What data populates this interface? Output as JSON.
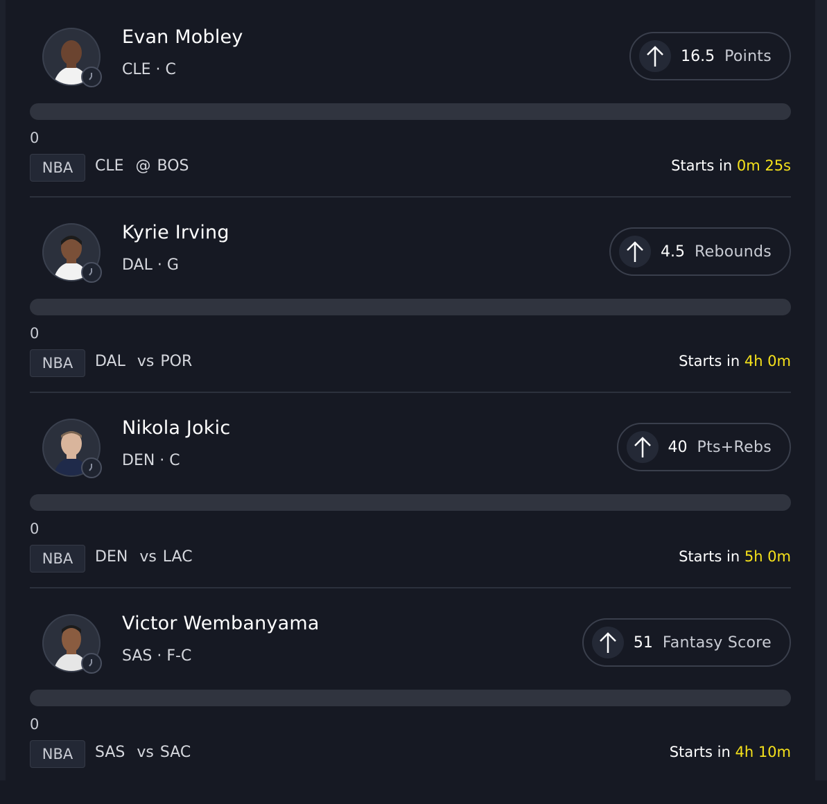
{
  "colors": {
    "background": "#161923",
    "countdown": "#f5e11b",
    "track": "#30343f"
  },
  "cards": [
    {
      "name": "Evan Mobley",
      "meta": "CLE · C",
      "direction_icon": "arrow-up-icon",
      "line": "16.5",
      "stat": "Points",
      "progress": 0,
      "current": "0",
      "league": "NBA",
      "team": "CLE",
      "separator": "@",
      "opponent": "BOS",
      "starts_label": "Starts in ",
      "countdown": "0m 25s"
    },
    {
      "name": "Kyrie Irving",
      "meta": "DAL · G",
      "direction_icon": "arrow-up-icon",
      "line": "4.5",
      "stat": "Rebounds",
      "progress": 0,
      "current": "0",
      "league": "NBA",
      "team": "DAL",
      "separator": "vs",
      "opponent": "POR",
      "starts_label": "Starts in ",
      "countdown": "4h 0m"
    },
    {
      "name": "Nikola Jokic",
      "meta": "DEN · C",
      "direction_icon": "arrow-up-icon",
      "line": "40",
      "stat": "Pts+Rebs",
      "progress": 0,
      "current": "0",
      "league": "NBA",
      "team": "DEN",
      "separator": "vs",
      "opponent": "LAC",
      "starts_label": "Starts in ",
      "countdown": "5h 0m"
    },
    {
      "name": "Victor Wembanyama",
      "meta": "SAS · F-C",
      "direction_icon": "arrow-up-icon",
      "line": "51",
      "stat": "Fantasy Score",
      "progress": 0,
      "current": "0",
      "league": "NBA",
      "team": "SAS",
      "separator": "vs",
      "opponent": "SAC",
      "starts_label": "Starts in ",
      "countdown": "4h 10m"
    }
  ]
}
